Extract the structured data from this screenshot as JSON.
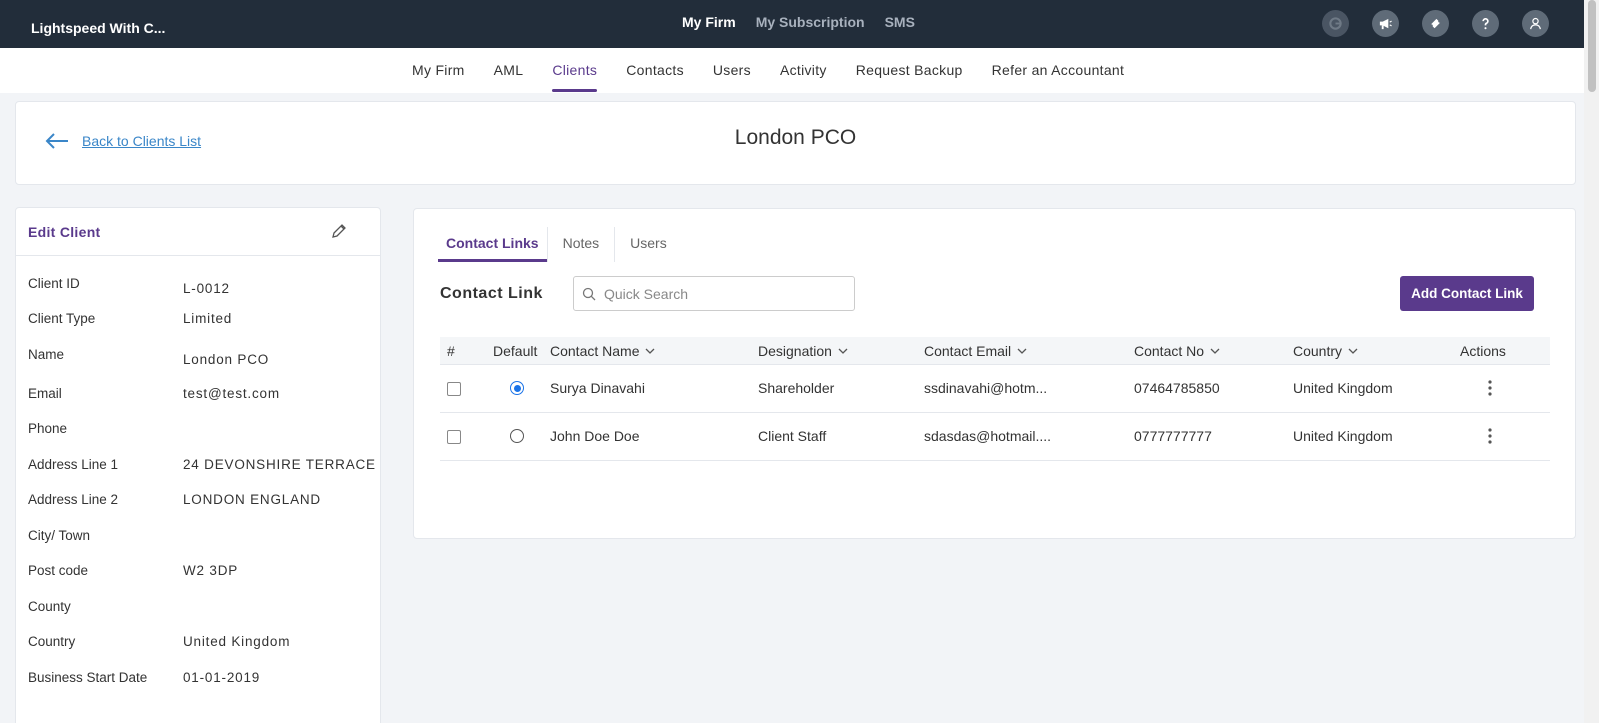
{
  "topbar": {
    "brand": "Lightspeed With C...",
    "nav": [
      {
        "label": "My Firm",
        "active": true
      },
      {
        "label": "My Subscription",
        "active": false
      },
      {
        "label": "SMS",
        "active": false
      }
    ],
    "icons": [
      "google-icon",
      "megaphone-icon",
      "ticket-icon",
      "help-icon",
      "user-icon"
    ]
  },
  "subnav": {
    "items": [
      {
        "label": "My Firm",
        "active": false
      },
      {
        "label": "AML",
        "active": false
      },
      {
        "label": "Clients",
        "active": true
      },
      {
        "label": "Contacts",
        "active": false
      },
      {
        "label": "Users",
        "active": false
      },
      {
        "label": "Activity",
        "active": false
      },
      {
        "label": "Request Backup",
        "active": false
      },
      {
        "label": "Refer an Accountant",
        "active": false
      }
    ]
  },
  "header": {
    "back_label": "Back to Clients List",
    "title": "London PCO"
  },
  "edit_client": {
    "title": "Edit Client",
    "fields": [
      {
        "label": "Client ID",
        "value": "L-0012"
      },
      {
        "label": "Client Type",
        "value": "Limited"
      },
      {
        "label": "Name",
        "value": "London PCO"
      },
      {
        "label": "Email",
        "value": "test@test.com"
      },
      {
        "label": "Phone",
        "value": ""
      },
      {
        "label": "Address Line 1",
        "value": "24 DEVONSHIRE TERRACE"
      },
      {
        "label": "Address Line 2",
        "value": "LONDON ENGLAND"
      },
      {
        "label": "City/ Town",
        "value": ""
      },
      {
        "label": "Post code",
        "value": "W2 3DP"
      },
      {
        "label": "County",
        "value": ""
      },
      {
        "label": "Country",
        "value": "United Kingdom"
      },
      {
        "label": "Business Start Date",
        "value": "01-01-2019"
      }
    ]
  },
  "contacts": {
    "tabs": [
      {
        "label": "Contact Links",
        "active": true
      },
      {
        "label": "Notes",
        "active": false
      },
      {
        "label": "Users",
        "active": false
      }
    ],
    "section_title": "Contact Link",
    "search_placeholder": "Quick Search",
    "add_button": "Add Contact Link",
    "columns": [
      "#",
      "Default",
      "Contact Name",
      "Designation",
      "Contact Email",
      "Contact No",
      "Country",
      "Actions"
    ],
    "rows": [
      {
        "default": true,
        "name": "Surya Dinavahi",
        "designation": "Shareholder",
        "email": "ssdinavahi@hotm...",
        "phone": "07464785850",
        "country": "United Kingdom"
      },
      {
        "default": false,
        "name": "John Doe Doe",
        "designation": "Client Staff",
        "email": "sdasdas@hotmail....",
        "phone": "0777777777",
        "country": "United Kingdom"
      }
    ]
  },
  "colors": {
    "topbar_bg": "#222d3a",
    "accent": "#5a3a8c",
    "link": "#3a86c8",
    "radio": "#1a73e8"
  }
}
